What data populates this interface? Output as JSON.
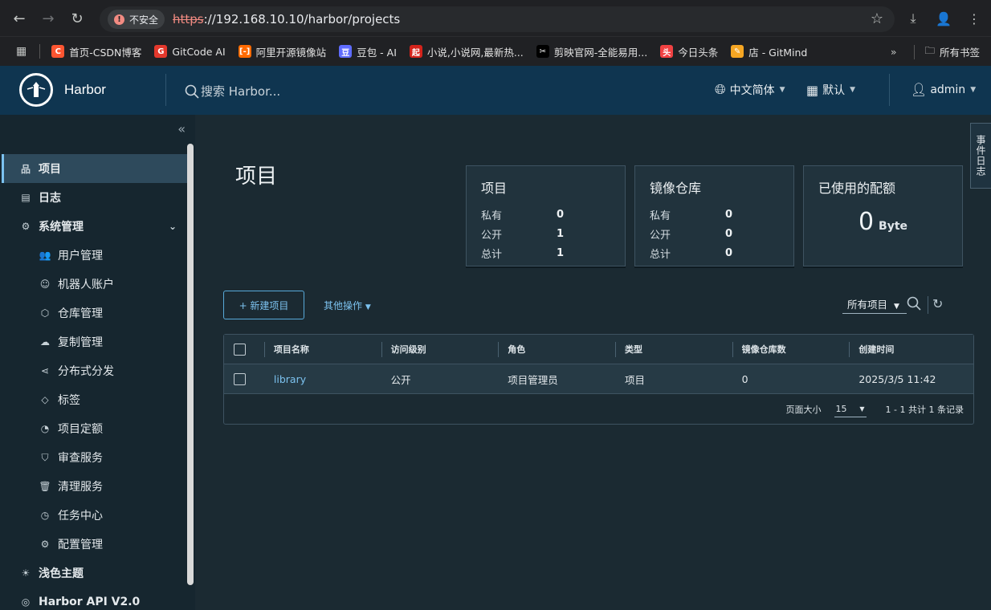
{
  "browser": {
    "insecure_label": "不安全",
    "url_scheme": "https",
    "url_rest": "://192.168.10.10/harbor/projects",
    "bookmarks": [
      {
        "label": "首页-CSDN博客",
        "color": "#fc5531",
        "glyph": "C"
      },
      {
        "label": "GitCode AI",
        "color": "#e3382c",
        "glyph": "G"
      },
      {
        "label": "阿里开源镜像站",
        "color": "#ff6a00",
        "glyph": "[-]"
      },
      {
        "label": "豆包 - AI",
        "color": "#5f6cff",
        "glyph": "豆"
      },
      {
        "label": "小说,小说网,最新热...",
        "color": "#d4231b",
        "glyph": "起"
      },
      {
        "label": "剪映官网-全能易用...",
        "color": "#000000",
        "glyph": "✂"
      },
      {
        "label": "今日头条",
        "color": "#f04142",
        "glyph": "头"
      },
      {
        "label": "店 - GitMind",
        "color": "#f5a623",
        "glyph": "✎"
      }
    ],
    "all_bookmarks": "所有书签"
  },
  "header": {
    "brand": "Harbor",
    "search_placeholder": "搜索 Harbor...",
    "language": "中文简体",
    "datetime_format": "默认",
    "user": "admin"
  },
  "sidebar": {
    "items": [
      {
        "label": "项目",
        "icon": "projects-icon",
        "glyph": "品",
        "level": "top",
        "active": true
      },
      {
        "label": "日志",
        "icon": "logs-icon",
        "glyph": "▤",
        "level": "top"
      },
      {
        "label": "系统管理",
        "icon": "admin-icon",
        "glyph": "⚙",
        "level": "top",
        "expanded": true
      },
      {
        "label": "用户管理",
        "icon": "users-icon",
        "glyph": "👥",
        "level": "sub"
      },
      {
        "label": "机器人账户",
        "icon": "robot-icon",
        "glyph": "☺",
        "level": "sub"
      },
      {
        "label": "仓库管理",
        "icon": "registry-icon",
        "glyph": "⬡",
        "level": "sub"
      },
      {
        "label": "复制管理",
        "icon": "replication-icon",
        "glyph": "☁",
        "level": "sub"
      },
      {
        "label": "分布式分发",
        "icon": "distribution-icon",
        "glyph": "⋖",
        "level": "sub"
      },
      {
        "label": "标签",
        "icon": "tag-icon",
        "glyph": "◇",
        "level": "sub"
      },
      {
        "label": "项目定额",
        "icon": "quota-icon",
        "glyph": "◔",
        "level": "sub"
      },
      {
        "label": "审查服务",
        "icon": "shield-icon",
        "glyph": "⛉",
        "level": "sub"
      },
      {
        "label": "清理服务",
        "icon": "trash-icon",
        "glyph": "🗑",
        "level": "sub"
      },
      {
        "label": "任务中心",
        "icon": "gauge-icon",
        "glyph": "◷",
        "level": "sub"
      },
      {
        "label": "配置管理",
        "icon": "gear-icon",
        "glyph": "⚙",
        "level": "sub"
      },
      {
        "label": "浅色主题",
        "icon": "sun-icon",
        "glyph": "☀",
        "level": "top"
      },
      {
        "label": "Harbor API V2.0",
        "icon": "api-icon",
        "glyph": "◎",
        "level": "top"
      }
    ]
  },
  "main": {
    "title": "项目",
    "event_log_tab": "事件日志",
    "cards": {
      "projects": {
        "title": "项目",
        "rows": [
          {
            "k": "私有",
            "v": "0"
          },
          {
            "k": "公开",
            "v": "1"
          },
          {
            "k": "总计",
            "v": "1"
          }
        ]
      },
      "repos": {
        "title": "镜像仓库",
        "rows": [
          {
            "k": "私有",
            "v": "0"
          },
          {
            "k": "公开",
            "v": "0"
          },
          {
            "k": "总计",
            "v": "0"
          }
        ]
      },
      "quota": {
        "title": "已使用的配额",
        "value": "0",
        "unit": "Byte"
      }
    },
    "new_project": "+ 新建项目",
    "other_actions": "其他操作",
    "filter": "所有项目",
    "table": {
      "headers": [
        "项目名称",
        "访问级别",
        "角色",
        "类型",
        "镜像仓库数",
        "创建时间"
      ],
      "rows": [
        [
          "library",
          "公开",
          "项目管理员",
          "项目",
          "0",
          "2025/3/5 11:42"
        ]
      ]
    },
    "pagination": {
      "page_size_label": "页面大小",
      "page_size": "15",
      "summary": "1 - 1 共计 1 条记录"
    }
  }
}
